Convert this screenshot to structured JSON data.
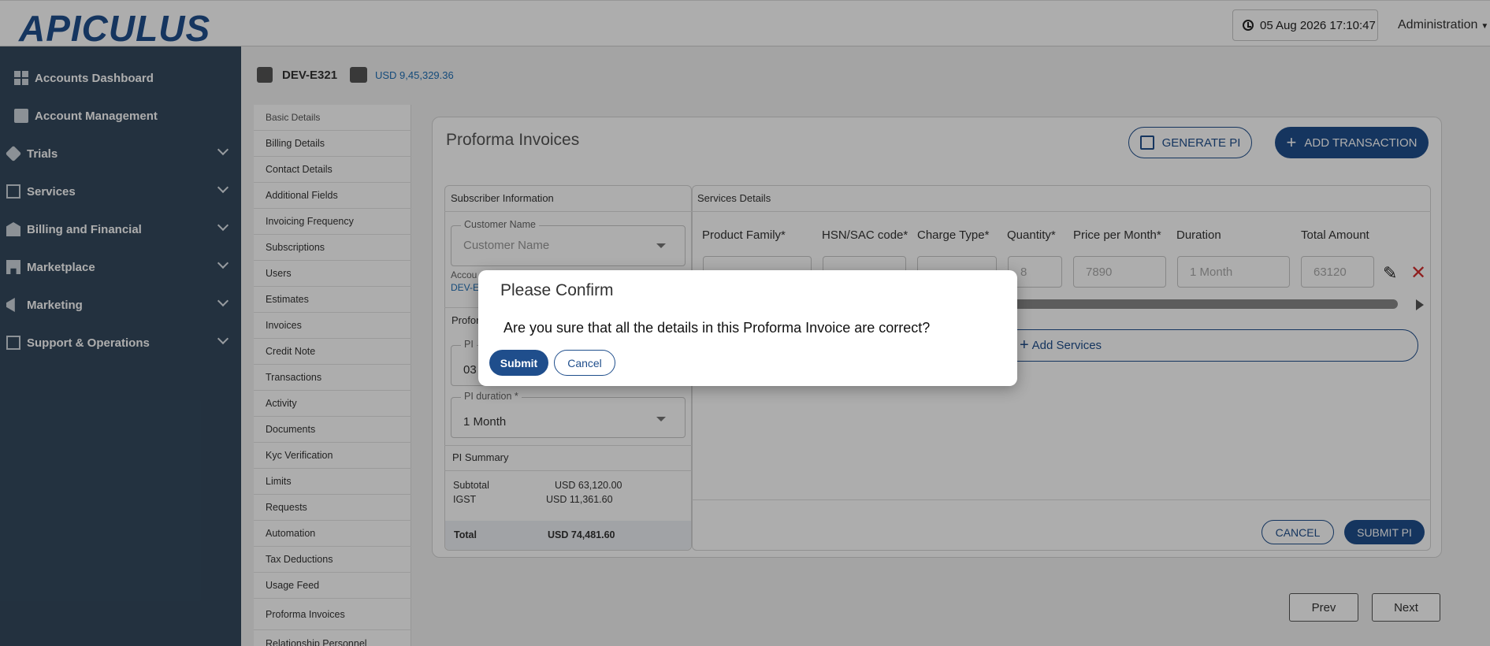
{
  "header": {
    "logo": "APICULUS",
    "datetime": "05 Aug 2026 17:10:47",
    "admin_label": "Administration"
  },
  "sidebar": {
    "items": [
      {
        "label": "Accounts Dashboard",
        "icon": "dashboard-icon"
      },
      {
        "label": "Account Management",
        "icon": "account-icon"
      },
      {
        "label": "Trials",
        "icon": "tag-icon"
      },
      {
        "label": "Services",
        "icon": "services-icon"
      },
      {
        "label": "Billing and Financial",
        "icon": "bank-icon"
      },
      {
        "label": "Marketplace",
        "icon": "store-icon"
      },
      {
        "label": "Marketing",
        "icon": "megaphone-icon"
      },
      {
        "label": "Support & Operations",
        "icon": "monitor-icon"
      }
    ]
  },
  "account": {
    "id": "DEV-E321",
    "balance": "USD 9,45,329.36"
  },
  "submenu": {
    "items": [
      "Basic Details",
      "Billing Details",
      "Contact Details",
      "Additional Fields",
      "Invoicing Frequency",
      "Subscriptions",
      "Users",
      "Estimates",
      "Invoices",
      "Credit Note",
      "Transactions",
      "Activity",
      "Documents",
      "Kyc Verification",
      "Limits",
      "Requests",
      "Automation",
      "Tax Deductions",
      "Usage Feed",
      "Proforma Invoices",
      "Relationship Personnel"
    ]
  },
  "main": {
    "title": "Proforma Invoices",
    "generate_pi": "GENERATE PI",
    "add_transaction": "ADD TRANSACTION",
    "subscriber_head": "Subscriber Information",
    "customer_name_label": "Customer Name",
    "customer_name_placeholder": "Customer Name",
    "account_label_partial": "Accou",
    "account_value_partial": "DEV-E",
    "proforma_partial": "Profor",
    "pi_label_partial": "PI",
    "pi_value_partial": "03",
    "pi_duration_label": "PI duration *",
    "pi_duration_value": "1 Month",
    "pi_summary_head": "PI Summary",
    "subtotal_label": "Subtotal",
    "subtotal_value": "USD 63,120.00",
    "igst_label": "IGST",
    "igst_value": "USD 11,361.60",
    "total_label": "Total",
    "total_value": "USD 74,481.60",
    "services_head": "Services Details",
    "columns": [
      "Product Family*",
      "HSN/SAC code*",
      "Charge Type*",
      "Quantity*",
      "Price per Month*",
      "Duration",
      "Total Amount"
    ],
    "row": {
      "quantity": "8",
      "price": "7890",
      "duration": "1 Month",
      "total": "63120"
    },
    "add_services": "Add Services",
    "cancel": "CANCEL",
    "submit_pi": "SUBMIT PI",
    "prev": "Prev",
    "next": "Next"
  },
  "dialog": {
    "title": "Please Confirm",
    "message": "Are you sure that all the details in this Proforma Invoice are correct?",
    "submit": "Submit",
    "cancel": "Cancel"
  },
  "colors": {
    "brand": "#1f4e8c",
    "sidebar": "#34495e",
    "danger": "#d32f2f"
  }
}
